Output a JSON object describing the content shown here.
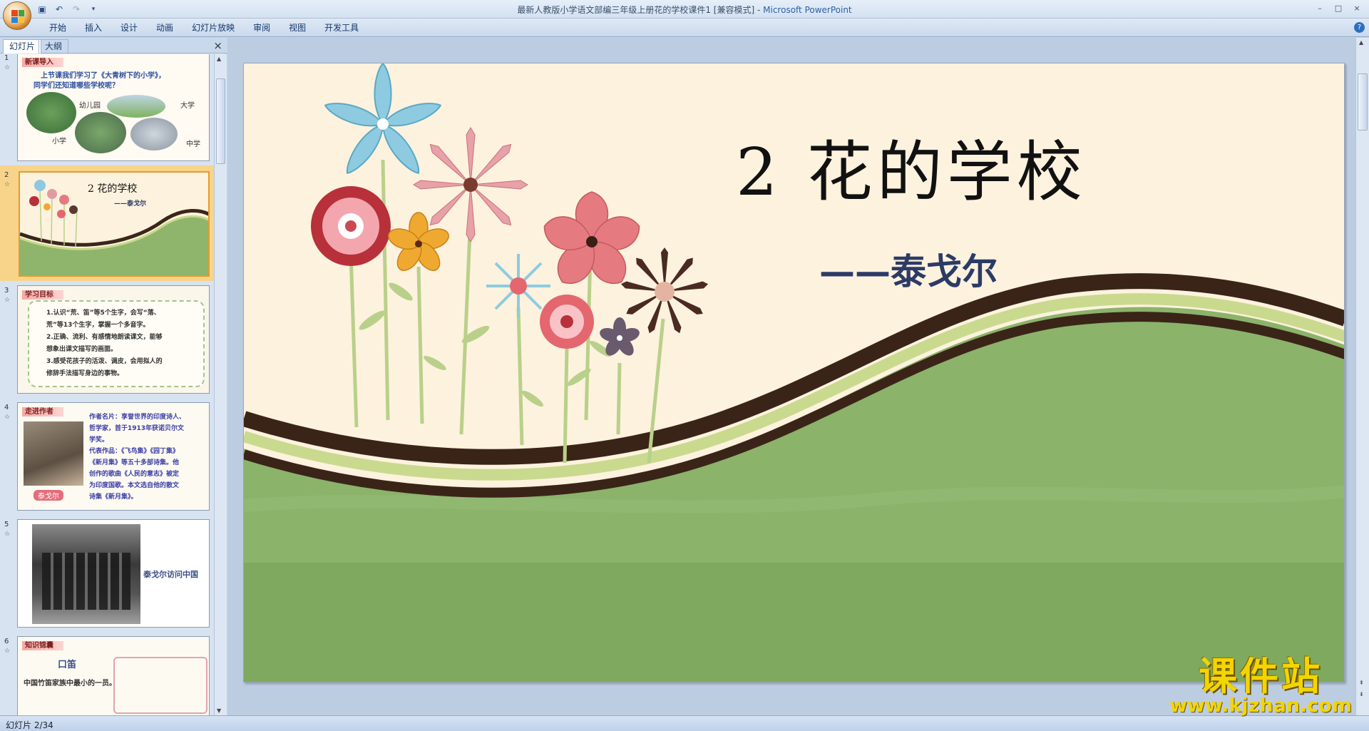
{
  "window": {
    "title": "最新人教版小学语文部编三年级上册花的学校课件1 [兼容模式] - ",
    "app_name": "Microsoft PowerPoint",
    "controls": [
      "–",
      "□",
      "×"
    ]
  },
  "quick_access": [
    "save-icon",
    "undo-icon",
    "redo-icon",
    "customize-icon"
  ],
  "ribbon": {
    "tabs": [
      "开始",
      "插入",
      "设计",
      "动画",
      "幻灯片放映",
      "审阅",
      "视图",
      "开发工具"
    ],
    "help": "?"
  },
  "left_pane": {
    "tabs": [
      "幻灯片",
      "大纲"
    ],
    "close": "×",
    "slides": [
      {
        "num": "1",
        "tag": "新课导入",
        "line1": "上节课我们学习了《大青树下的小学》，",
        "line2": "同学们还知道哪些学校呢？",
        "labels": [
          "幼儿园",
          "大学",
          "小学",
          "中学"
        ]
      },
      {
        "num": "2",
        "title": "2 花的学校",
        "subtitle": "——泰戈尔"
      },
      {
        "num": "3",
        "tag": "学习目标",
        "lines": [
          "1.认识“荒、笛”等5个生字，会写“落、",
          "荒”等13个生字，掌握一个多音字。",
          "2.正确、流利、有感情地朗读课文，能够",
          "想象出课文描写的画面。",
          "3.感受花孩子的活泼、调皮，会用拟人的",
          "修辞手法描写身边的事物。"
        ]
      },
      {
        "num": "4",
        "tag": "走进作者",
        "caption": "泰戈尔",
        "lines": [
          "作者名片：享誉世界的印度诗人、",
          "哲学家，首于1913年获诺贝尔文",
          "学奖。",
          "代表作品：《飞鸟集》《园丁集》",
          "《新月集》等五十多部诗集。他",
          "创作的歌曲《人民的意志》被定",
          "为印度国歌。本文选自他的散文",
          "诗集《新月集》。"
        ]
      },
      {
        "num": "5",
        "caption": "泰戈尔访问中国"
      },
      {
        "num": "6",
        "tag": "知识锦囊",
        "title": "口笛",
        "line1": "中国竹笛家族中最小的一员。"
      }
    ]
  },
  "slide": {
    "title": "2 花的学校",
    "author": "——泰戈尔"
  },
  "status": {
    "text": "幻灯片 2/34"
  },
  "watermark": {
    "line1": "课件站",
    "line2": "www.kjzhan.com"
  }
}
